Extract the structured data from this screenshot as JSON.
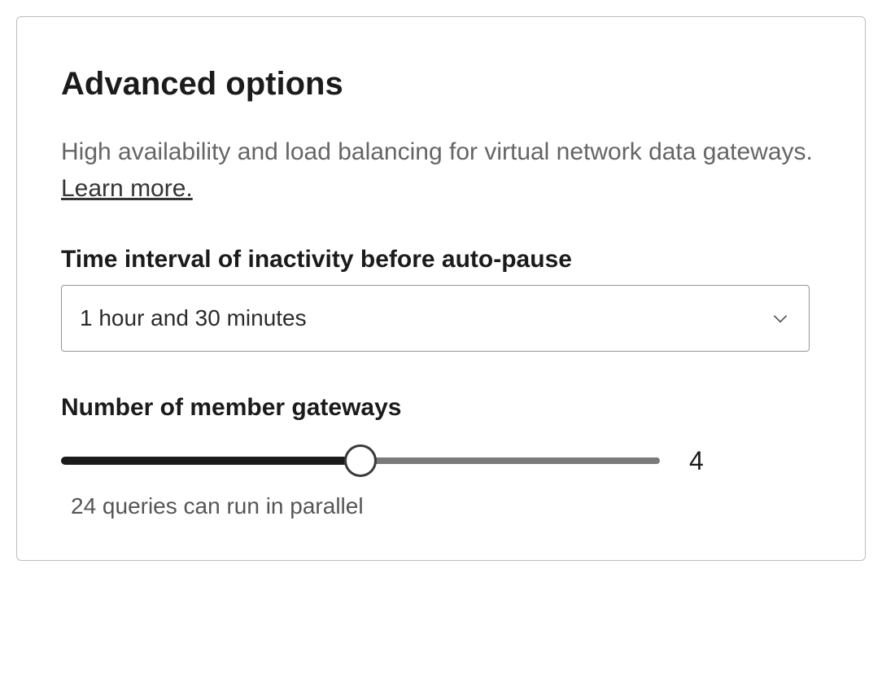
{
  "panel": {
    "title": "Advanced options",
    "description_prefix": "High availability and load balancing for virtual network data gateways. ",
    "learn_more": "Learn more."
  },
  "autopause": {
    "label": "Time interval of inactivity before auto-pause",
    "selected": "1 hour and 30 minutes"
  },
  "gateways": {
    "label": "Number of member gateways",
    "value": "4",
    "helper": "24 queries can run in parallel"
  }
}
